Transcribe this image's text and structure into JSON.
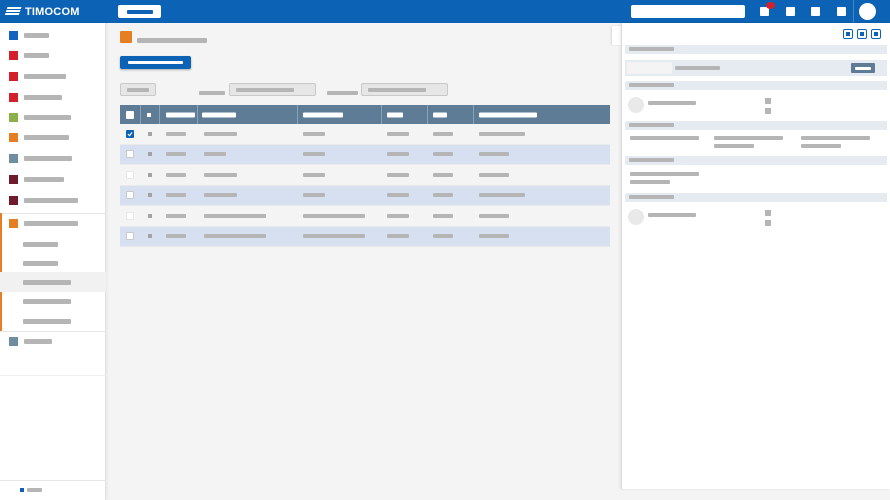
{
  "app": {
    "brand": "TIMOCOM",
    "brand_color": "#0c62b4",
    "accent_orange": "#e67e22"
  },
  "topbar": {
    "icons": [
      "logo-stripes-icon",
      "search-field",
      "notification-icon",
      "square-icon",
      "square-icon",
      "square-icon",
      "avatar"
    ]
  },
  "sidebar": {
    "items": [
      {
        "color": "#1565c0",
        "icon": "module-icon"
      },
      {
        "color": "#d4202a",
        "icon": "module-icon"
      },
      {
        "color": "#d4202a",
        "icon": "module-icon"
      },
      {
        "color": "#d4202a",
        "icon": "module-icon"
      },
      {
        "color": "#8bb04a",
        "icon": "module-icon"
      },
      {
        "color": "#e67e22",
        "icon": "module-icon"
      },
      {
        "color": "#6f8fa0",
        "icon": "module-icon"
      },
      {
        "color": "#6e1b2b",
        "icon": "module-icon"
      },
      {
        "color": "#6e1b2b",
        "icon": "module-icon"
      },
      {
        "color": "#e67e22",
        "icon": "module-icon"
      },
      {
        "color": "#6f8fa0",
        "icon": "module-icon"
      }
    ]
  },
  "main": {
    "table": {
      "selected_rows": [
        true,
        false,
        false,
        false,
        false,
        false
      ]
    }
  }
}
